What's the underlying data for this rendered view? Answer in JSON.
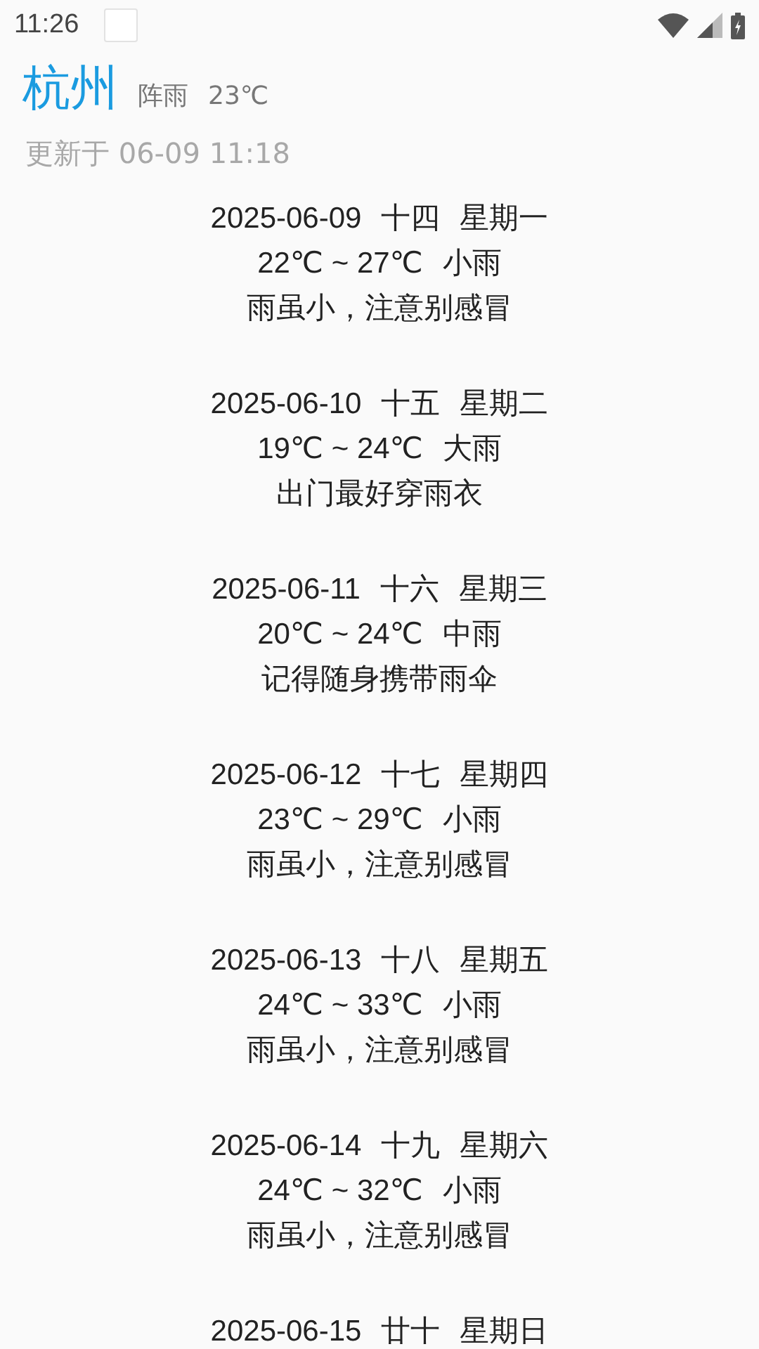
{
  "status_bar": {
    "time": "11:26"
  },
  "header": {
    "city": "杭州",
    "condition": "阵雨",
    "temperature": "23℃",
    "updated": "更新于 06-09 11:18"
  },
  "days": [
    {
      "date": "2025-06-09",
      "lunar": "十四",
      "weekday": "星期一",
      "temp": "22℃ ~ 27℃",
      "weather": "小雨",
      "tip": "雨虽小，注意别感冒"
    },
    {
      "date": "2025-06-10",
      "lunar": "十五",
      "weekday": "星期二",
      "temp": "19℃ ~ 24℃",
      "weather": "大雨",
      "tip": "出门最好穿雨衣"
    },
    {
      "date": "2025-06-11",
      "lunar": "十六",
      "weekday": "星期三",
      "temp": "20℃ ~ 24℃",
      "weather": "中雨",
      "tip": "记得随身携带雨伞"
    },
    {
      "date": "2025-06-12",
      "lunar": "十七",
      "weekday": "星期四",
      "temp": "23℃ ~ 29℃",
      "weather": "小雨",
      "tip": "雨虽小，注意别感冒"
    },
    {
      "date": "2025-06-13",
      "lunar": "十八",
      "weekday": "星期五",
      "temp": "24℃ ~ 33℃",
      "weather": "小雨",
      "tip": "雨虽小，注意别感冒"
    },
    {
      "date": "2025-06-14",
      "lunar": "十九",
      "weekday": "星期六",
      "temp": "24℃ ~ 32℃",
      "weather": "小雨",
      "tip": "雨虽小，注意别感冒"
    },
    {
      "date": "2025-06-15",
      "lunar": "廿十",
      "weekday": "星期日"
    }
  ]
}
